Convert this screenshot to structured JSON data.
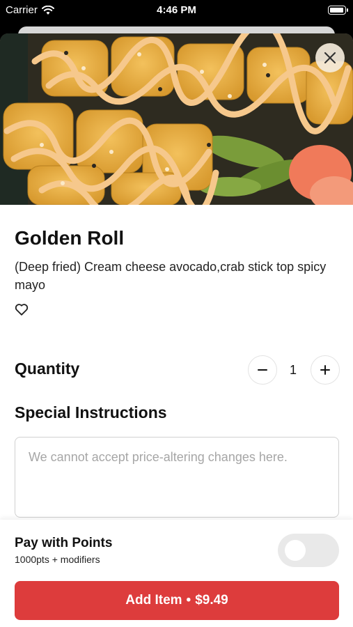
{
  "status_bar": {
    "carrier": "Carrier",
    "time": "4:46 PM",
    "battery_level": 1.0
  },
  "item": {
    "name": "Golden Roll",
    "description": "(Deep fried) Cream cheese avocado,crab stick top spicy mayo",
    "favorite_icon": "heart-outline-icon",
    "close_icon": "close-icon"
  },
  "quantity": {
    "label": "Quantity",
    "value": "1",
    "decrement_icon": "minus-icon",
    "increment_icon": "plus-icon"
  },
  "special_instructions": {
    "label": "Special Instructions",
    "value": "",
    "placeholder": "We cannot accept price-altering changes here."
  },
  "pay_with_points": {
    "title": "Pay with Points",
    "subtitle": "1000pts + modifiers",
    "enabled": false
  },
  "add_button": {
    "label": "Add Item",
    "separator": "•",
    "price": "$9.49",
    "color": "#dd3c3c"
  }
}
